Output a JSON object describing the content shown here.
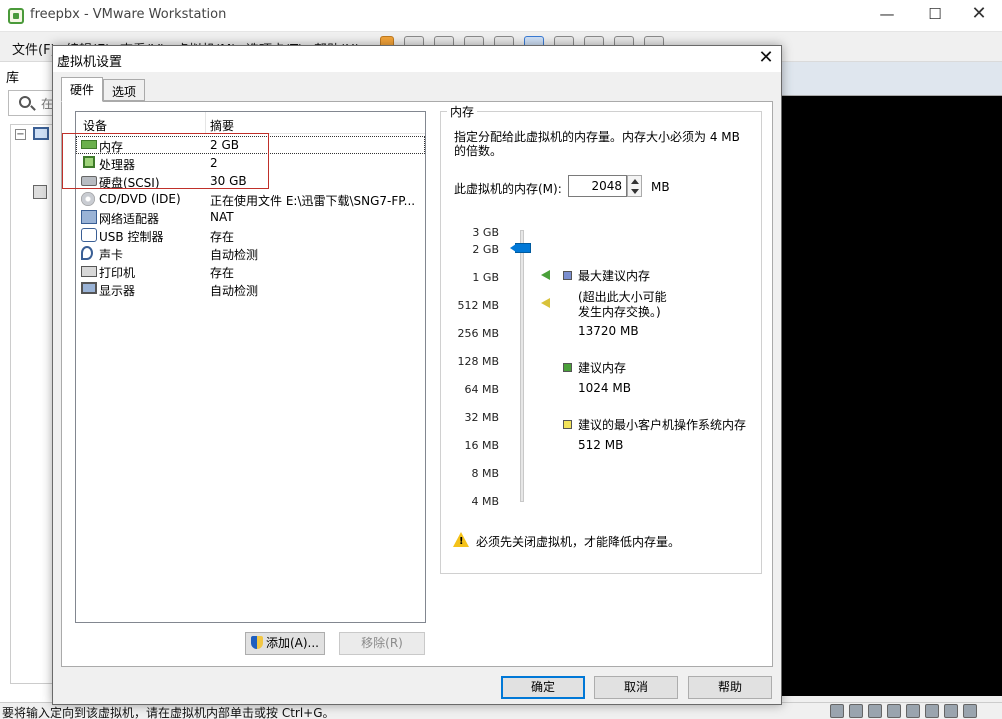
{
  "app": {
    "title": "freepbx - VMware Workstation",
    "menus": [
      "文件(F)",
      "编辑(E)",
      "查看(V)",
      "虚拟机(M)",
      "选项卡(T)",
      "帮助(H)"
    ],
    "library_label": "库",
    "search_placeholder": "在",
    "status_text": "要将输入定向到该虚拟机，请在虚拟机内部单击或按 Ctrl+G。"
  },
  "dialog": {
    "title": "虚拟机设置",
    "tabs": [
      "硬件",
      "选项"
    ],
    "columns": [
      "设备",
      "摘要"
    ],
    "devices": [
      {
        "icon": "memory-icon",
        "name": "内存",
        "summary": "2 GB"
      },
      {
        "icon": "processor-icon",
        "name": "处理器",
        "summary": "2"
      },
      {
        "icon": "hard-disk-icon",
        "name": "硬盘(SCSI)",
        "summary": "30 GB"
      },
      {
        "icon": "cd-dvd-icon",
        "name": "CD/DVD (IDE)",
        "summary": "正在使用文件 E:\\迅雷下载\\SNG7-FP..."
      },
      {
        "icon": "network-adapter-icon",
        "name": "网络适配器",
        "summary": "NAT"
      },
      {
        "icon": "usb-controller-icon",
        "name": "USB 控制器",
        "summary": "存在"
      },
      {
        "icon": "sound-card-icon",
        "name": "声卡",
        "summary": "自动检测"
      },
      {
        "icon": "printer-icon",
        "name": "打印机",
        "summary": "存在"
      },
      {
        "icon": "display-icon",
        "name": "显示器",
        "summary": "自动检测"
      }
    ],
    "add_button": "添加(A)...",
    "remove_button": "移除(R)",
    "ok_button": "确定",
    "cancel_button": "取消",
    "help_button": "帮助",
    "memory": {
      "group_title": "内存",
      "description": "指定分配给此虚拟机的内存量。内存大小必须为 4 MB 的倍数。",
      "field_label": "此虚拟机的内存(M):",
      "value": "2048",
      "unit": "MB",
      "scale": [
        "3 GB",
        "2 GB",
        "1 GB",
        "512 MB",
        "256 MB",
        "128 MB",
        "64 MB",
        "32 MB",
        "16 MB",
        "8 MB",
        "4 MB"
      ],
      "max_recommended_label": "最大建议内存",
      "max_recommended_note": "(超出此大小可能\n发生内存交换。)",
      "max_recommended_value": "13720 MB",
      "recommended_label": "建议内存",
      "recommended_value": "1024 MB",
      "min_guest_label": "建议的最小客户机操作系统内存",
      "min_guest_value": "512 MB",
      "warning": "必须先关闭虚拟机，才能降低内存量。"
    }
  },
  "colors": {
    "highlight_border": "#c0302a",
    "accent": "#0078d7",
    "max_recommended": "#7b8fd0",
    "recommended": "#4aa03a",
    "min_guest": "#f2e35a"
  }
}
